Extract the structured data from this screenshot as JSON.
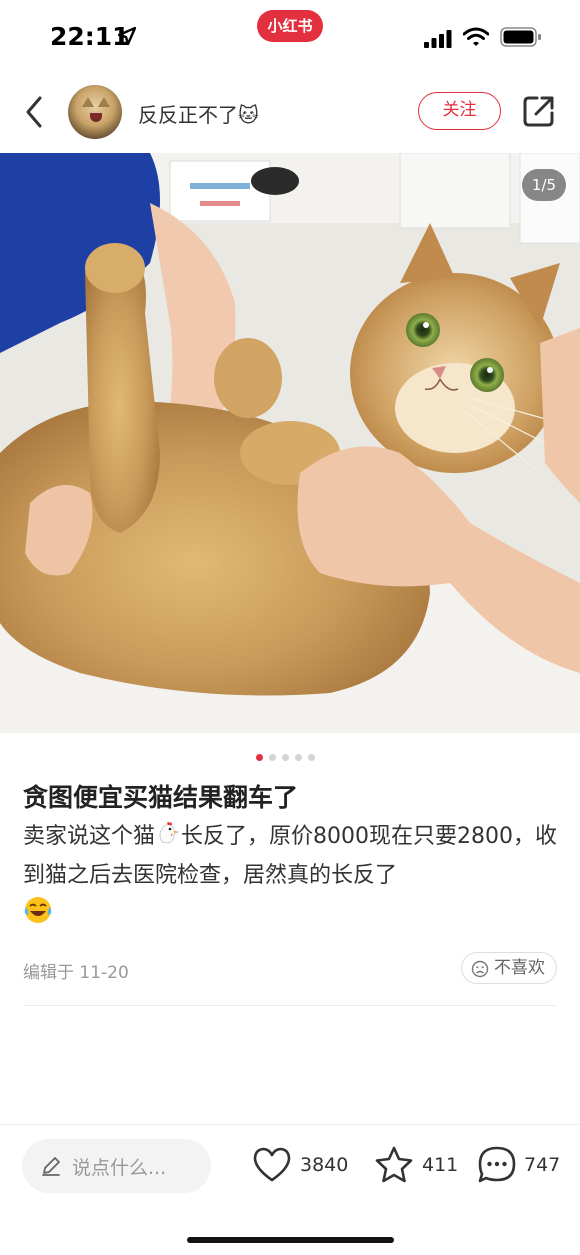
{
  "status_bar": {
    "time": "22:11",
    "app_brand": "小红书",
    "brand_color": "#e3303f",
    "icons": [
      "location-arrow-icon",
      "signal-icon",
      "wifi-icon",
      "battery-icon"
    ]
  },
  "header": {
    "username": "反反正不了🐱",
    "follow_label": "关注",
    "icons": [
      "back-icon",
      "avatar",
      "share-icon"
    ]
  },
  "photo": {
    "page_counter": "1/5",
    "current_page": 1,
    "total_pages": 5
  },
  "post": {
    "title": "贪图便宜买猫结果翻车了",
    "body_part1": "卖家说这个猫",
    "body_part2": "长反了，原价8000现在只要2800，收到猫之后去医院检查，居然真的长反了",
    "edit_date": "编辑于 11-20",
    "dislike_label": "不喜欢"
  },
  "bottom_bar": {
    "comment_placeholder": "说点什么...",
    "like_count": "3840",
    "collect_count": "411",
    "comment_count": "747",
    "icons": [
      "pencil-icon",
      "heart-icon",
      "star-icon",
      "comment-bubble-icon"
    ]
  }
}
